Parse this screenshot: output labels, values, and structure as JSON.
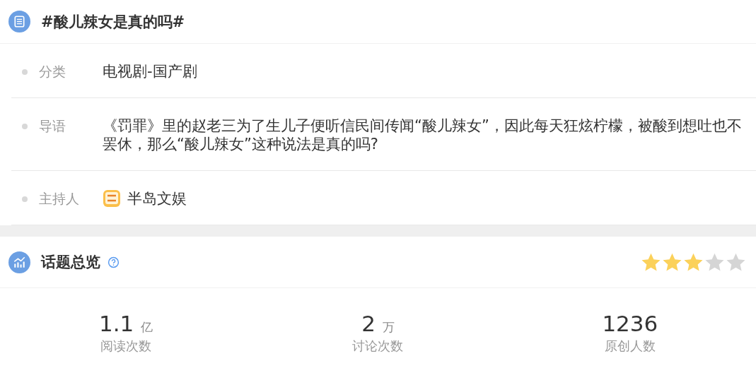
{
  "topic": {
    "title": "#酸儿辣女是真的吗#"
  },
  "details": [
    {
      "kind": "text",
      "label": "分类",
      "value": "电视剧-国产剧"
    },
    {
      "kind": "text",
      "label": "导语",
      "value": "《罚罪》里的赵老三为了生儿子便听信民间传闻“酸儿辣女”，因此每天狂炫柠檬，被酸到想吐也不罢休，那么“酸儿辣女”这种说法是真的吗?"
    },
    {
      "kind": "host",
      "label": "主持人",
      "value": "半岛文娱"
    }
  ],
  "overview": {
    "title": "话题总览",
    "stars": 3,
    "stats": [
      {
        "number": "1.1",
        "unit": "亿",
        "label": "阅读次数"
      },
      {
        "number": "2",
        "unit": "万",
        "label": "讨论次数"
      },
      {
        "number": "1236",
        "label": "原创人数"
      }
    ]
  }
}
